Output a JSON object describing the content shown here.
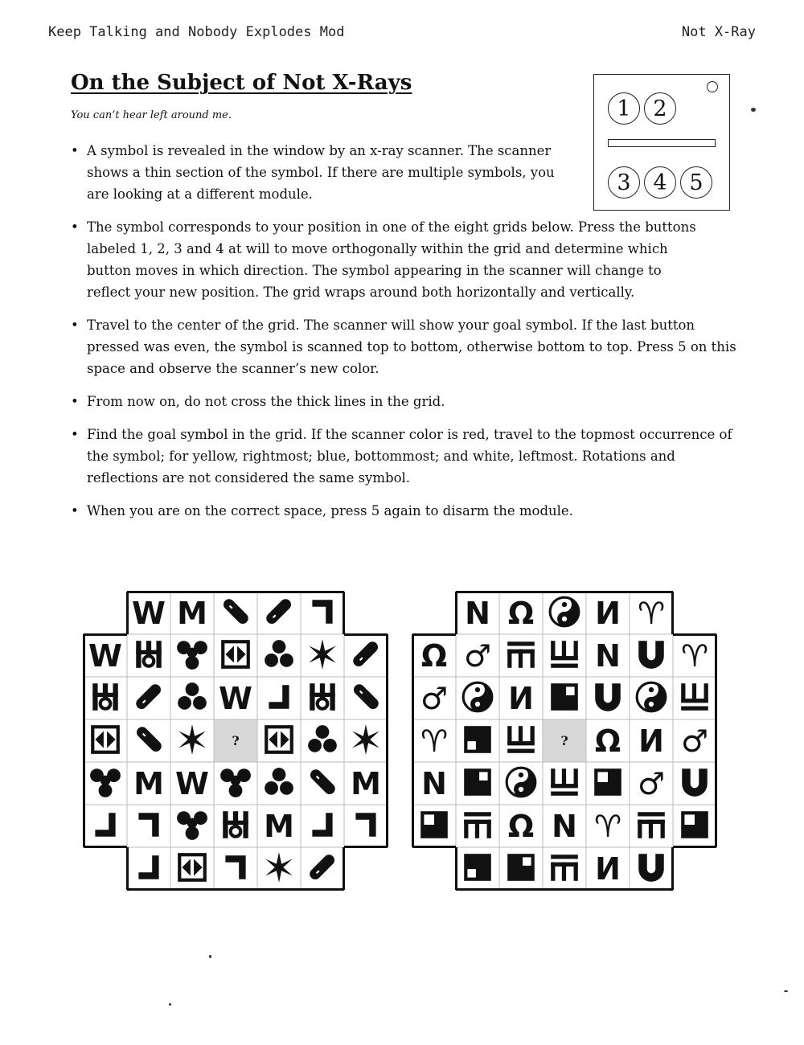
{
  "header": {
    "left": "Keep Talking and Nobody Explodes Mod",
    "right": "Not X-Ray"
  },
  "title": "On the Subject of Not X-Rays",
  "flavor": "You can’t hear left around me.",
  "rules": [
    "A symbol is revealed in the window by an x-ray scanner. The scanner shows a thin section of the symbol. If there are multiple symbols, you are looking at a different module.",
    "The symbol corresponds to your position in one of the eight grids below. Press the buttons labeled 1, 2, 3 and 4 at will to move orthogonally within the grid and determine which button moves in which direction. The symbol appearing in the scanner will change to reflect your new position. The grid wraps around both horizontally and vertically.",
    "Travel to the center of the grid. The scanner will show your goal symbol. If the last button pressed was even, the symbol is scanned top to bottom, otherwise bottom to top. Press 5 on this space and observe the scanner’s new color.",
    "From now on, do not cross the thick lines in the grid.",
    "Find the goal symbol in the grid. If the scanner color is red, travel to the topmost occurrence of the symbol; for yellow, rightmost; blue, bottommost; and white, leftmost. Rotations and reflections are not considered the same symbol.",
    "When you are on the correct space, press 5 again to disarm the module."
  ],
  "module_buttons": [
    "1",
    "2",
    "3",
    "4",
    "5"
  ],
  "center_mark": "?",
  "grids": [
    {
      "rows": [
        [
          "",
          "W",
          "M",
          "pill-nw",
          "pill-ne",
          "corner-tr",
          ""
        ],
        [
          "W",
          "ankh-h",
          "trefoil-y",
          "box-arrows",
          "trefoil",
          "star6",
          "pill-ne"
        ],
        [
          "ankh-h",
          "pill-ne",
          "trefoil",
          "W",
          "corner-br",
          "ankh-h",
          "pill-nw"
        ],
        [
          "box-arrows",
          "pill-nw",
          "star6",
          "?",
          "box-arrows",
          "trefoil",
          "star6"
        ],
        [
          "trefoil-y",
          "M",
          "W",
          "trefoil-y",
          "trefoil",
          "pill-nw",
          "M"
        ],
        [
          "corner-br",
          "corner-tr",
          "trefoil-y",
          "ankh-h",
          "M",
          "corner-br",
          "corner-tr"
        ],
        [
          "",
          "corner-br",
          "box-arrows",
          "corner-tr",
          "star6",
          "pill-ne",
          ""
        ]
      ]
    },
    {
      "rows": [
        [
          "",
          "N",
          "Ω",
          "yin-yang",
          "И",
          "♈",
          ""
        ],
        [
          "Ω",
          "♂",
          "stair-up",
          "stair-down",
          "N",
          "U-bold",
          "♈"
        ],
        [
          "♂",
          "yin-yang",
          "И",
          "square-tr",
          "U-bold",
          "yin-yang",
          "stair-down"
        ],
        [
          "♈",
          "square-bl",
          "stair-down",
          "?",
          "Ω",
          "И",
          "♂"
        ],
        [
          "N",
          "square-tr",
          "yin-yang",
          "stair-down",
          "square-tl",
          "♂",
          "U-bold"
        ],
        [
          "square-tl",
          "stair-up",
          "Ω",
          "N",
          "♈",
          "stair-up",
          "square-tl"
        ],
        [
          "",
          "square-bl",
          "square-tr",
          "stair-up",
          "И",
          "U-bold",
          ""
        ]
      ]
    }
  ]
}
